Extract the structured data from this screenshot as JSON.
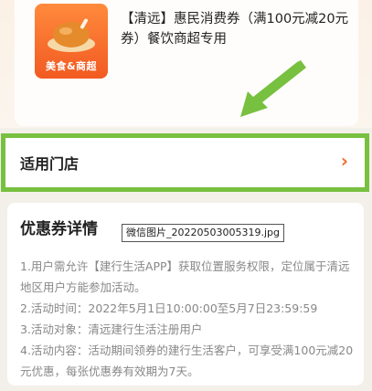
{
  "coupon": {
    "thumb_label": "美食&商超",
    "title": "【清远】惠民消费券（满100元减20元券）餐饮商超专用"
  },
  "store_row": {
    "label": "适用门店",
    "chevron": "›"
  },
  "tooltip": {
    "filename": "微信图片_20220503005319.jpg"
  },
  "details": {
    "title": "优惠券详情",
    "lines": [
      "1.用户需允许【建行生活APP】获取位置服务权限，定位属于清远地区用户方能参加活动。",
      "2.活动时间：2022年5月1日10:00:00至5月7日23:59:59",
      "3.活动对象：清远建行生活注册用户",
      "4.活动内容：活动期间领券的建行生活客户，可享受满100元减20元优惠，每张优惠券有效期为7天。"
    ]
  },
  "colors": {
    "accent": "#f06d2e",
    "highlight": "#78c040"
  }
}
